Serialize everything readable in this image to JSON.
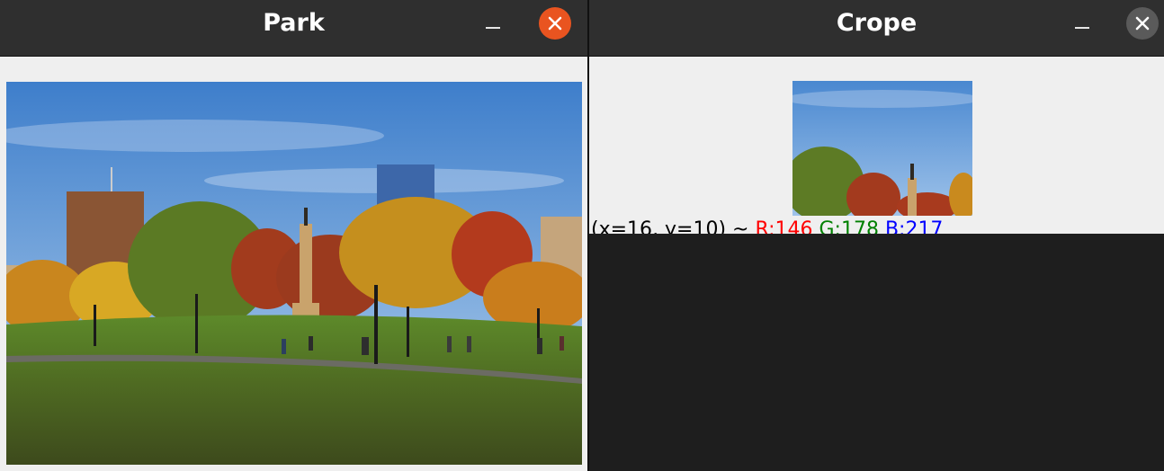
{
  "park_window": {
    "title": "Park",
    "minimize_icon": "minimize-icon",
    "close_icon": "close-icon",
    "close_color": "#e95420"
  },
  "crope_window": {
    "title": "Crope",
    "minimize_icon": "minimize-icon",
    "close_icon": "close-icon",
    "close_color": "#5a5a5a",
    "readout": {
      "coords": "(x=16, y=10) ~ ",
      "r": "R:146",
      "g": "G:178",
      "b": "B:217"
    }
  },
  "colors": {
    "titlebar": "#2f2f2f",
    "content_bg": "#efefef",
    "desktop_bg": "#1e1e1e"
  }
}
